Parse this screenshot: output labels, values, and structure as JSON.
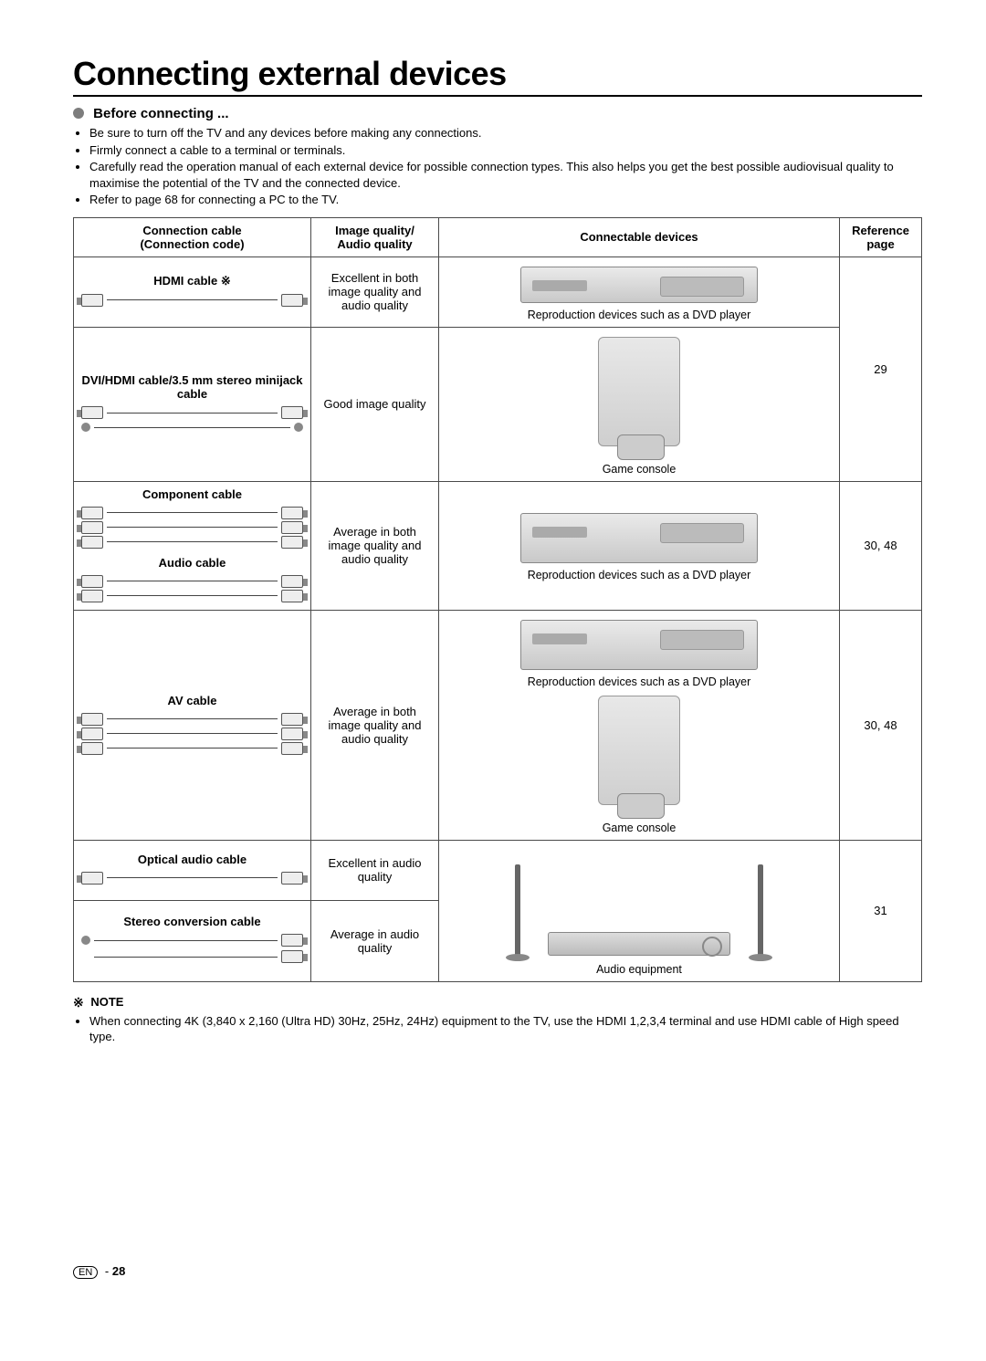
{
  "title": "Connecting external devices",
  "before": {
    "heading": "Before connecting ...",
    "bullets": [
      "Be sure to turn off the TV and any devices before making any connections.",
      "Firmly connect a cable to a terminal or terminals.",
      "Carefully read the operation manual of each external device for possible connection types. This also helps you get the best possible audiovisual quality to maximise the potential of the TV and the connected device.",
      "Refer to page 68 for connecting a PC to the TV."
    ]
  },
  "table": {
    "headers": {
      "col1a": "Connection cable",
      "col1b": "(Connection code)",
      "col2a": "Image quality/",
      "col2b": "Audio quality",
      "col3": "Connectable devices",
      "col4a": "Reference",
      "col4b": "page"
    },
    "rows": {
      "hdmi": {
        "label": "HDMI cable ※",
        "quality": "Excellent in both image quality and audio quality",
        "device_caption": "Reproduction devices such as a DVD player"
      },
      "dvi": {
        "label": "DVI/HDMI cable/3.5 mm stereo minijack cable",
        "quality": "Good image quality",
        "device_caption": "Game console"
      },
      "ref_hdmi_dvi": "29",
      "component": {
        "label": "Component cable",
        "audio_label": "Audio cable",
        "quality": "Average in both image quality and audio quality",
        "device_caption": "Reproduction devices such as a DVD player",
        "ref": "30, 48"
      },
      "av": {
        "label": "AV cable",
        "quality": "Average in both image quality and audio quality",
        "device_caption1": "Reproduction devices such as a DVD player",
        "device_caption2": "Game console",
        "ref": "30, 48"
      },
      "optical": {
        "label": "Optical audio cable",
        "quality": "Excellent in audio quality"
      },
      "stereo": {
        "label": "Stereo conversion cable",
        "quality": "Average in audio quality"
      },
      "audio_caption": "Audio equipment",
      "ref_audio": "31"
    }
  },
  "note": {
    "heading": "※ NOTE",
    "items": [
      "When connecting 4K (3,840 x 2,160 (Ultra HD) 30Hz, 25Hz, 24Hz) equipment to the TV, use the HDMI 1,2,3,4 terminal and use HDMI cable of High speed type."
    ]
  },
  "footer": {
    "lang": "EN",
    "sep": " - ",
    "page": "28"
  }
}
